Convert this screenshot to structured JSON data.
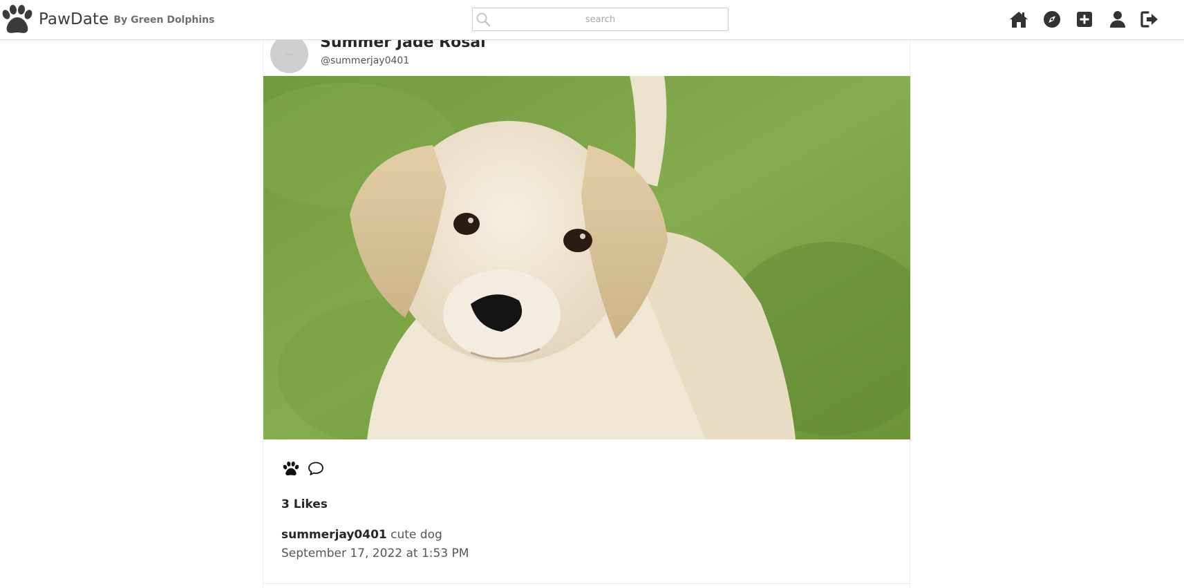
{
  "brand": {
    "name": "PawDate",
    "tagline": "By Green Dolphins"
  },
  "search": {
    "placeholder": "search",
    "value": ""
  },
  "nav": {
    "icons": [
      "home-icon",
      "explore-compass-icon",
      "add-post-icon",
      "profile-icon",
      "logout-icon"
    ]
  },
  "post": {
    "display_name": "Summer Jade Rosal",
    "username": "@summerjay0401",
    "likes": "3 Likes",
    "caption_user": "summerjay0401",
    "caption_text": "cute dog",
    "timestamp": "September 17, 2022 at 1:53 PM"
  },
  "colors": {
    "icon": "#333333",
    "text_primary": "#262626",
    "text_secondary": "#555555",
    "border": "#d6d6d6",
    "grass": "#7fa64a",
    "puppy": "#eee3cc"
  }
}
